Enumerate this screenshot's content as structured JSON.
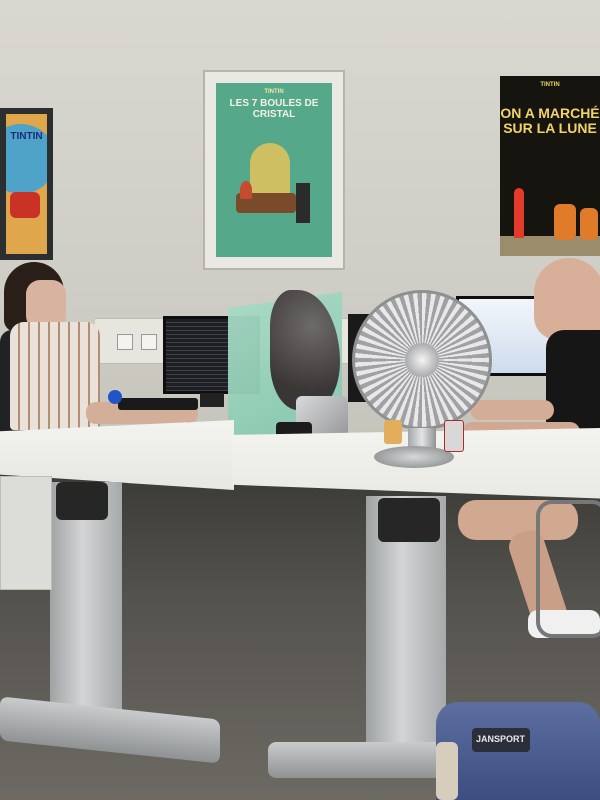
{
  "scene": {
    "posters": [
      {
        "name": "left-poster",
        "text": "TINTIN"
      },
      {
        "name": "center-poster",
        "text": "LES 7 BOULES DE CRISTAL",
        "series": "TINTIN"
      },
      {
        "name": "right-poster",
        "series": "TINTIN",
        "text": "ON A MARCHÉ SUR LA LUNE"
      }
    ],
    "bag_label": "JANSPORT"
  }
}
